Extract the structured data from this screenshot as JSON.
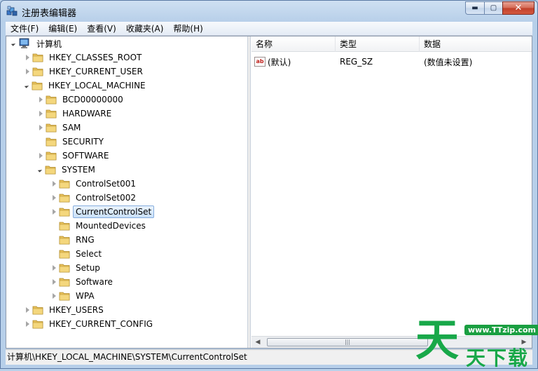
{
  "window": {
    "title": "注册表编辑器",
    "min_glyph": "▬",
    "max_glyph": "▢",
    "close_glyph": "✕"
  },
  "menu": [
    "文件(F)",
    "编辑(E)",
    "查看(V)",
    "收藏夹(A)",
    "帮助(H)"
  ],
  "tree": {
    "root": "计算机",
    "nodes": [
      {
        "label": "HKEY_CLASSES_ROOT",
        "level": 1,
        "state": "closed"
      },
      {
        "label": "HKEY_CURRENT_USER",
        "level": 1,
        "state": "closed"
      },
      {
        "label": "HKEY_LOCAL_MACHINE",
        "level": 1,
        "state": "open"
      },
      {
        "label": "BCD00000000",
        "level": 2,
        "state": "closed"
      },
      {
        "label": "HARDWARE",
        "level": 2,
        "state": "closed"
      },
      {
        "label": "SAM",
        "level": 2,
        "state": "closed"
      },
      {
        "label": "SECURITY",
        "level": 2,
        "state": "none"
      },
      {
        "label": "SOFTWARE",
        "level": 2,
        "state": "closed"
      },
      {
        "label": "SYSTEM",
        "level": 2,
        "state": "open"
      },
      {
        "label": "ControlSet001",
        "level": 3,
        "state": "closed"
      },
      {
        "label": "ControlSet002",
        "level": 3,
        "state": "closed"
      },
      {
        "label": "CurrentControlSet",
        "level": 3,
        "state": "closed",
        "selected": true
      },
      {
        "label": "MountedDevices",
        "level": 3,
        "state": "none"
      },
      {
        "label": "RNG",
        "level": 3,
        "state": "none"
      },
      {
        "label": "Select",
        "level": 3,
        "state": "none"
      },
      {
        "label": "Setup",
        "level": 3,
        "state": "closed"
      },
      {
        "label": "Software",
        "level": 3,
        "state": "closed"
      },
      {
        "label": "WPA",
        "level": 3,
        "state": "closed"
      },
      {
        "label": "HKEY_USERS",
        "level": 1,
        "state": "closed"
      },
      {
        "label": "HKEY_CURRENT_CONFIG",
        "level": 1,
        "state": "closed"
      }
    ]
  },
  "list": {
    "columns": [
      "名称",
      "类型",
      "数据"
    ],
    "rows": [
      {
        "icon": "ab",
        "name": "(默认)",
        "type": "REG_SZ",
        "data": "(数值未设置)"
      }
    ],
    "scroll_thumb_glyph": "|||"
  },
  "status": "计算机\\HKEY_LOCAL_MACHINE\\SYSTEM\\CurrentControlSet",
  "watermark": {
    "big": "天",
    "url": "www.TTzip.com",
    "small": "天下载"
  },
  "colors": {
    "folder": "#e8c15a",
    "selection_border": "#84acdd",
    "watermark_green": "#18a849"
  }
}
